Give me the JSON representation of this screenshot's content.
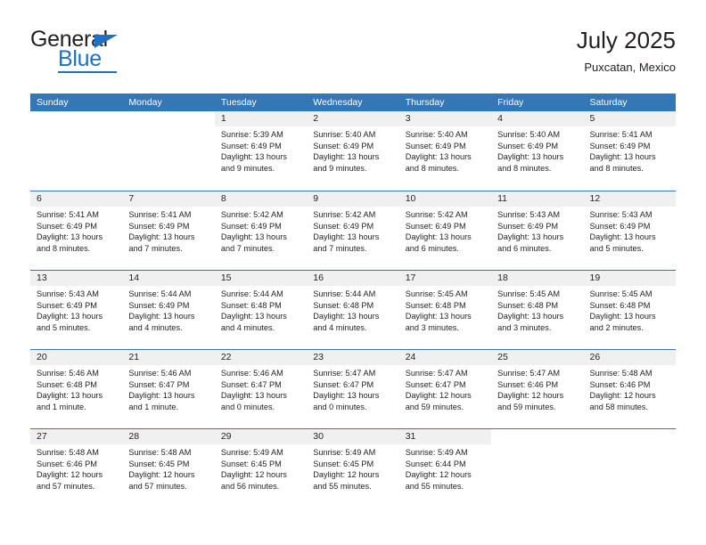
{
  "logo": {
    "word_one": "General",
    "word_two": "Blue",
    "triangle_icon": "blue-triangle-icon"
  },
  "header": {
    "title": "July 2025",
    "subtitle": "Puxcatan, Mexico"
  },
  "colors": {
    "header_blue": "#3576b5",
    "logo_blue": "#1f6fc4",
    "date_band_gray": "#f0f0f0",
    "text": "#231f20"
  },
  "weekdays": [
    "Sunday",
    "Monday",
    "Tuesday",
    "Wednesday",
    "Thursday",
    "Friday",
    "Saturday"
  ],
  "weeks": [
    [
      {
        "date": "",
        "sunrise": "",
        "sunset": "",
        "daylight": "",
        "empty": true
      },
      {
        "date": "",
        "sunrise": "",
        "sunset": "",
        "daylight": "",
        "empty": true
      },
      {
        "date": "1",
        "sunrise": "Sunrise: 5:39 AM",
        "sunset": "Sunset: 6:49 PM",
        "daylight": "Daylight: 13 hours and 9 minutes."
      },
      {
        "date": "2",
        "sunrise": "Sunrise: 5:40 AM",
        "sunset": "Sunset: 6:49 PM",
        "daylight": "Daylight: 13 hours and 9 minutes."
      },
      {
        "date": "3",
        "sunrise": "Sunrise: 5:40 AM",
        "sunset": "Sunset: 6:49 PM",
        "daylight": "Daylight: 13 hours and 8 minutes."
      },
      {
        "date": "4",
        "sunrise": "Sunrise: 5:40 AM",
        "sunset": "Sunset: 6:49 PM",
        "daylight": "Daylight: 13 hours and 8 minutes."
      },
      {
        "date": "5",
        "sunrise": "Sunrise: 5:41 AM",
        "sunset": "Sunset: 6:49 PM",
        "daylight": "Daylight: 13 hours and 8 minutes."
      }
    ],
    [
      {
        "date": "6",
        "sunrise": "Sunrise: 5:41 AM",
        "sunset": "Sunset: 6:49 PM",
        "daylight": "Daylight: 13 hours and 8 minutes."
      },
      {
        "date": "7",
        "sunrise": "Sunrise: 5:41 AM",
        "sunset": "Sunset: 6:49 PM",
        "daylight": "Daylight: 13 hours and 7 minutes."
      },
      {
        "date": "8",
        "sunrise": "Sunrise: 5:42 AM",
        "sunset": "Sunset: 6:49 PM",
        "daylight": "Daylight: 13 hours and 7 minutes."
      },
      {
        "date": "9",
        "sunrise": "Sunrise: 5:42 AM",
        "sunset": "Sunset: 6:49 PM",
        "daylight": "Daylight: 13 hours and 7 minutes."
      },
      {
        "date": "10",
        "sunrise": "Sunrise: 5:42 AM",
        "sunset": "Sunset: 6:49 PM",
        "daylight": "Daylight: 13 hours and 6 minutes."
      },
      {
        "date": "11",
        "sunrise": "Sunrise: 5:43 AM",
        "sunset": "Sunset: 6:49 PM",
        "daylight": "Daylight: 13 hours and 6 minutes."
      },
      {
        "date": "12",
        "sunrise": "Sunrise: 5:43 AM",
        "sunset": "Sunset: 6:49 PM",
        "daylight": "Daylight: 13 hours and 5 minutes."
      }
    ],
    [
      {
        "date": "13",
        "sunrise": "Sunrise: 5:43 AM",
        "sunset": "Sunset: 6:49 PM",
        "daylight": "Daylight: 13 hours and 5 minutes."
      },
      {
        "date": "14",
        "sunrise": "Sunrise: 5:44 AM",
        "sunset": "Sunset: 6:49 PM",
        "daylight": "Daylight: 13 hours and 4 minutes."
      },
      {
        "date": "15",
        "sunrise": "Sunrise: 5:44 AM",
        "sunset": "Sunset: 6:48 PM",
        "daylight": "Daylight: 13 hours and 4 minutes."
      },
      {
        "date": "16",
        "sunrise": "Sunrise: 5:44 AM",
        "sunset": "Sunset: 6:48 PM",
        "daylight": "Daylight: 13 hours and 4 minutes."
      },
      {
        "date": "17",
        "sunrise": "Sunrise: 5:45 AM",
        "sunset": "Sunset: 6:48 PM",
        "daylight": "Daylight: 13 hours and 3 minutes."
      },
      {
        "date": "18",
        "sunrise": "Sunrise: 5:45 AM",
        "sunset": "Sunset: 6:48 PM",
        "daylight": "Daylight: 13 hours and 3 minutes."
      },
      {
        "date": "19",
        "sunrise": "Sunrise: 5:45 AM",
        "sunset": "Sunset: 6:48 PM",
        "daylight": "Daylight: 13 hours and 2 minutes."
      }
    ],
    [
      {
        "date": "20",
        "sunrise": "Sunrise: 5:46 AM",
        "sunset": "Sunset: 6:48 PM",
        "daylight": "Daylight: 13 hours and 1 minute."
      },
      {
        "date": "21",
        "sunrise": "Sunrise: 5:46 AM",
        "sunset": "Sunset: 6:47 PM",
        "daylight": "Daylight: 13 hours and 1 minute."
      },
      {
        "date": "22",
        "sunrise": "Sunrise: 5:46 AM",
        "sunset": "Sunset: 6:47 PM",
        "daylight": "Daylight: 13 hours and 0 minutes."
      },
      {
        "date": "23",
        "sunrise": "Sunrise: 5:47 AM",
        "sunset": "Sunset: 6:47 PM",
        "daylight": "Daylight: 13 hours and 0 minutes."
      },
      {
        "date": "24",
        "sunrise": "Sunrise: 5:47 AM",
        "sunset": "Sunset: 6:47 PM",
        "daylight": "Daylight: 12 hours and 59 minutes."
      },
      {
        "date": "25",
        "sunrise": "Sunrise: 5:47 AM",
        "sunset": "Sunset: 6:46 PM",
        "daylight": "Daylight: 12 hours and 59 minutes."
      },
      {
        "date": "26",
        "sunrise": "Sunrise: 5:48 AM",
        "sunset": "Sunset: 6:46 PM",
        "daylight": "Daylight: 12 hours and 58 minutes."
      }
    ],
    [
      {
        "date": "27",
        "sunrise": "Sunrise: 5:48 AM",
        "sunset": "Sunset: 6:46 PM",
        "daylight": "Daylight: 12 hours and 57 minutes."
      },
      {
        "date": "28",
        "sunrise": "Sunrise: 5:48 AM",
        "sunset": "Sunset: 6:45 PM",
        "daylight": "Daylight: 12 hours and 57 minutes."
      },
      {
        "date": "29",
        "sunrise": "Sunrise: 5:49 AM",
        "sunset": "Sunset: 6:45 PM",
        "daylight": "Daylight: 12 hours and 56 minutes."
      },
      {
        "date": "30",
        "sunrise": "Sunrise: 5:49 AM",
        "sunset": "Sunset: 6:45 PM",
        "daylight": "Daylight: 12 hours and 55 minutes."
      },
      {
        "date": "31",
        "sunrise": "Sunrise: 5:49 AM",
        "sunset": "Sunset: 6:44 PM",
        "daylight": "Daylight: 12 hours and 55 minutes."
      },
      {
        "date": "",
        "sunrise": "",
        "sunset": "",
        "daylight": "",
        "empty": true
      },
      {
        "date": "",
        "sunrise": "",
        "sunset": "",
        "daylight": "",
        "empty": true
      }
    ]
  ]
}
